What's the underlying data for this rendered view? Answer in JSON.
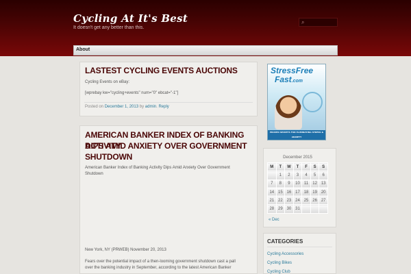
{
  "site": {
    "title": "Cycling At It's Best",
    "tagline": "It doesn't get any better than this."
  },
  "search": {
    "icon": "search-icon"
  },
  "nav": {
    "about": "About"
  },
  "posts": [
    {
      "title": "Lastest Cycling Events Auctions",
      "lines": [
        "Cycling Events on eBay:",
        "[wprebay kw=\"cycling+events\" num=\"0\" ebcat=\"-1\"]"
      ],
      "meta_prefix": "Posted on",
      "date": "December 1, 2013",
      "by": "by",
      "author": "admin",
      "reply": "Reply"
    },
    {
      "title_lines": [
        "American Banker Index of Banking Activity",
        "Dips Amid Anxiety Over Government",
        "Shutdown"
      ],
      "excerpt_lines": [
        "American Banker Index of Banking Activity Dips Amid Anxiety Over Government",
        "Shutdown"
      ],
      "dateline": "New York, NY (PRWEB) November 20, 2013",
      "body_lines": [
        "Fears over the potential impact of a then-looming government shutdown cast a pall",
        "over the banking industry in September, according to the latest American Banker"
      ]
    }
  ],
  "ad": {
    "brand": "StressFree",
    "brand2": "Fast",
    "domain": ".com",
    "tagline": "PROVEN SECRETS FOR ELIMINATING STRESS & ANXIETY"
  },
  "calendar": {
    "caption": "December 2015",
    "days": [
      "M",
      "T",
      "W",
      "T",
      "F",
      "S",
      "S"
    ],
    "weeks": [
      [
        "",
        "1",
        "2",
        "3",
        "4",
        "5",
        "6"
      ],
      [
        "7",
        "8",
        "9",
        "10",
        "11",
        "12",
        "13"
      ],
      [
        "14",
        "15",
        "16",
        "17",
        "18",
        "19",
        "20"
      ],
      [
        "21",
        "22",
        "23",
        "24",
        "25",
        "26",
        "27"
      ],
      [
        "28",
        "29",
        "30",
        "31",
        "",
        "",
        ""
      ]
    ],
    "prev": "« Dec"
  },
  "categories": {
    "title": "CATEGORIES",
    "items": [
      "Cycling Accessories",
      "Cycling Bikes",
      "Cycling Club"
    ]
  },
  "colors": {
    "header": "#4b0404",
    "title": "#4a0606",
    "link": "#2a7a9a",
    "background": "#e6e4e0"
  }
}
